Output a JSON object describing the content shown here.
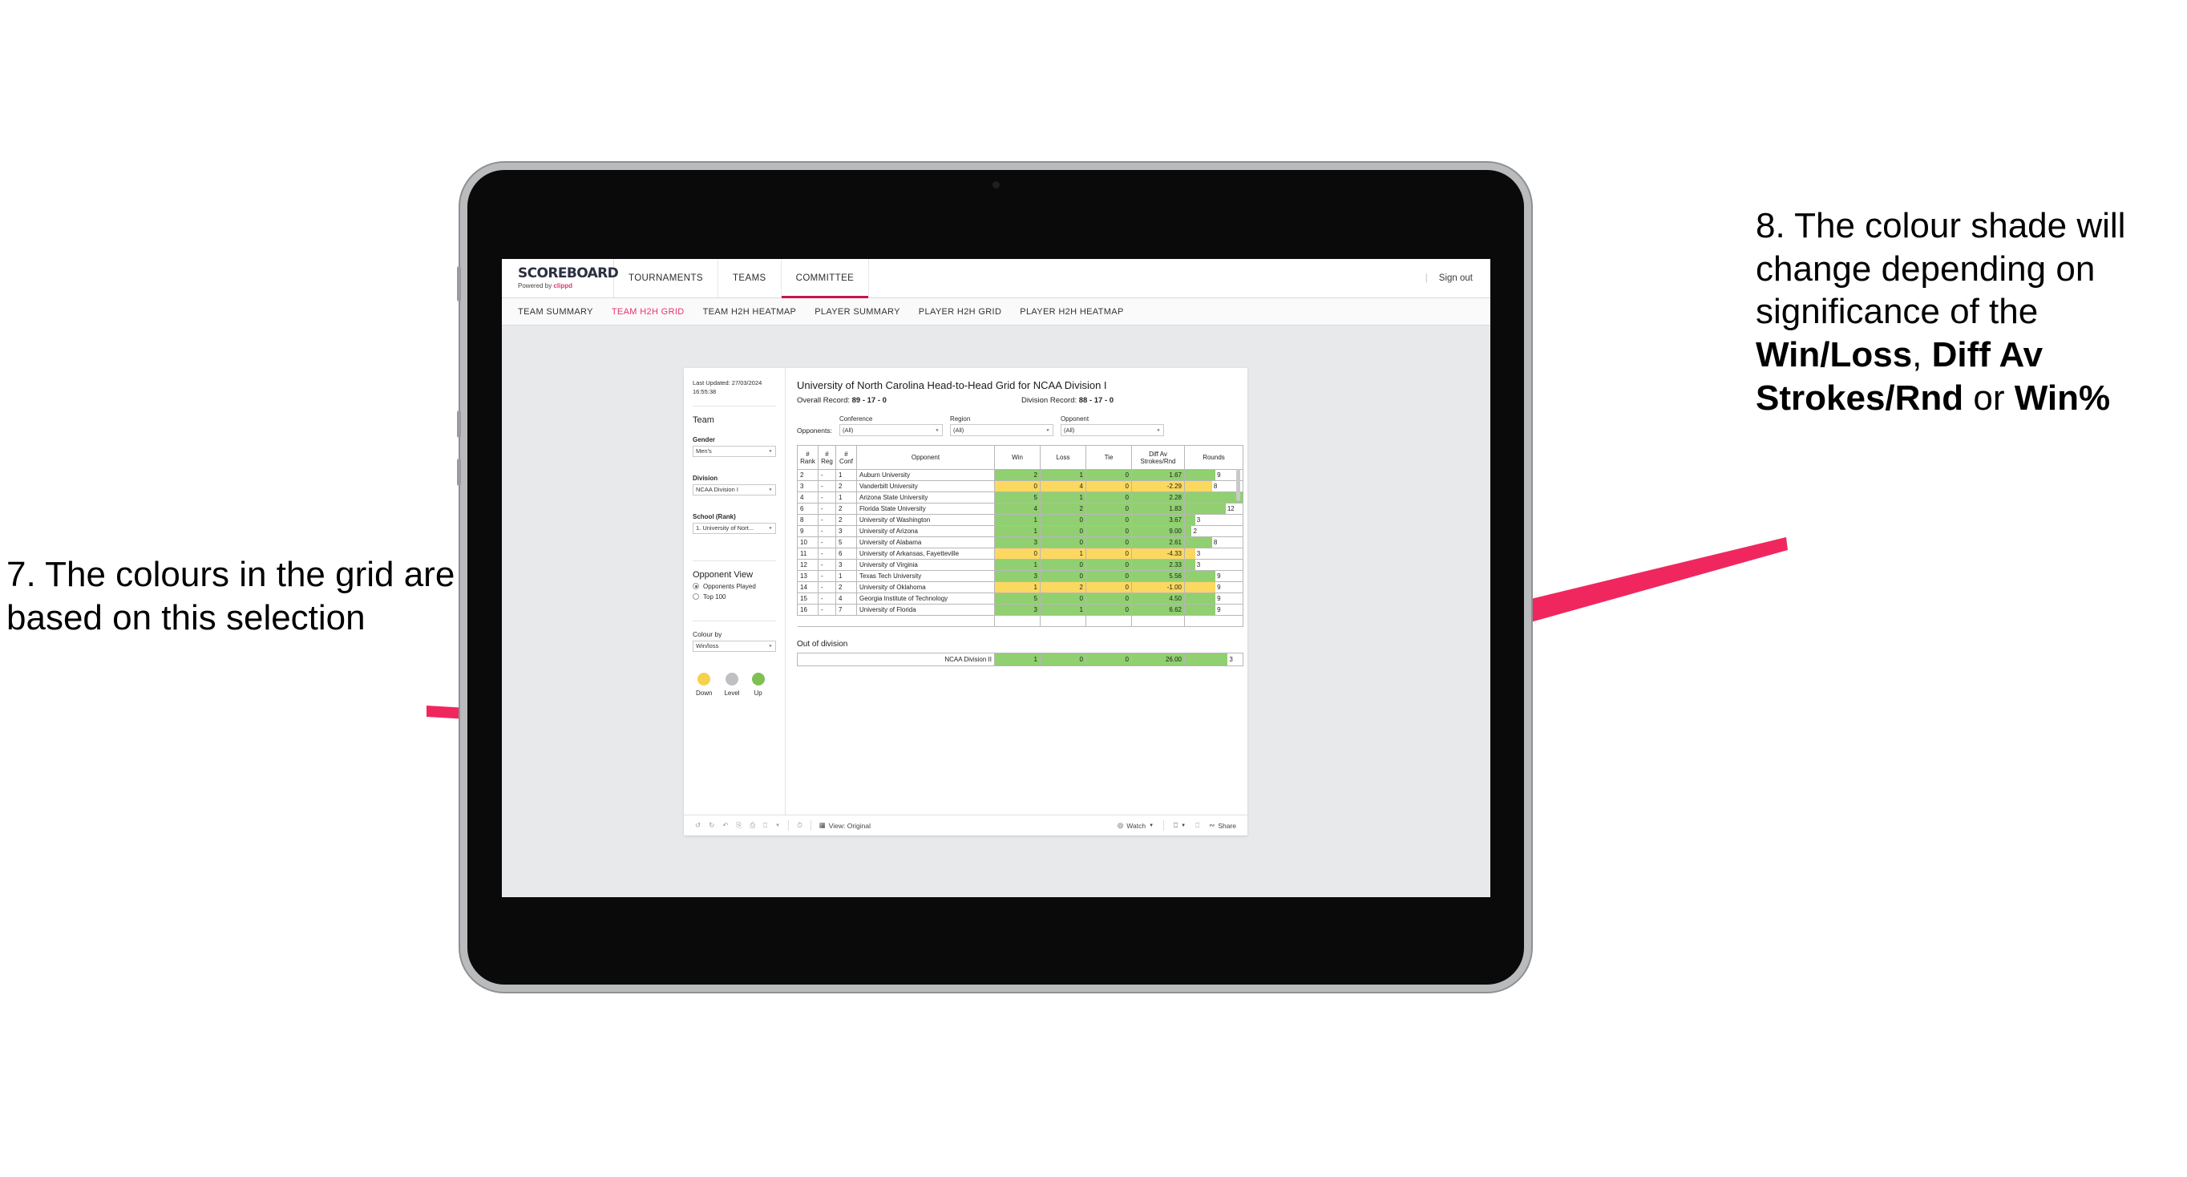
{
  "annotations": {
    "left": {
      "number": "7.",
      "text": "The colours in the grid are based on this selection"
    },
    "right": {
      "lead": "8. The colour shade will change depending on significance of the ",
      "bold1": "Win/Loss",
      "mid1": ", ",
      "bold2": "Diff Av Strokes/Rnd",
      "mid2": " or ",
      "bold3": "Win%"
    },
    "arrow_color": "#f0275f"
  },
  "topnav": {
    "brand_title": "SCOREBOARD",
    "brand_sub_prefix": "Powered by ",
    "brand_sub_accent": "clippd",
    "items": [
      {
        "label": "TOURNAMENTS",
        "active": false
      },
      {
        "label": "TEAMS",
        "active": false
      },
      {
        "label": "COMMITTEE",
        "active": true
      }
    ],
    "separator": "|",
    "sign_out": "Sign out",
    "accent_color": "#c8154b"
  },
  "subnav": {
    "items": [
      {
        "label": "TEAM SUMMARY",
        "active": false
      },
      {
        "label": "TEAM H2H GRID",
        "active": true
      },
      {
        "label": "TEAM H2H HEATMAP",
        "active": false
      },
      {
        "label": "PLAYER SUMMARY",
        "active": false
      },
      {
        "label": "PLAYER H2H GRID",
        "active": false
      },
      {
        "label": "PLAYER H2H HEATMAP",
        "active": false
      }
    ],
    "active_color": "#e8336b"
  },
  "sidebar": {
    "last_updated": "Last Updated: 27/03/2024 16:55:38",
    "team_heading": "Team",
    "gender": {
      "label": "Gender",
      "value": "Men's"
    },
    "division": {
      "label": "Division",
      "value": "NCAA Division I"
    },
    "school": {
      "label": "School (Rank)",
      "value": "1. University of Nort..."
    },
    "opponent_view": {
      "heading": "Opponent View",
      "options": [
        {
          "label": "Opponents Played",
          "selected": true
        },
        {
          "label": "Top 100",
          "selected": false
        }
      ]
    },
    "colour_by": {
      "label": "Colour by",
      "value": "Win/loss"
    },
    "legend": [
      {
        "label": "Down",
        "color": "#f5d24e"
      },
      {
        "label": "Level",
        "color": "#bfc0c2"
      },
      {
        "label": "Up",
        "color": "#7ec153"
      }
    ]
  },
  "viz": {
    "title": "University of North Carolina Head-to-Head Grid for NCAA Division I",
    "overall_record_label": "Overall Record: ",
    "overall_record_value": "89 - 17 - 0",
    "division_record_label": "Division Record: ",
    "division_record_value": "88 - 17 - 0",
    "opponents_label": "Opponents:",
    "filters": [
      {
        "label": "Conference",
        "value": "(All)"
      },
      {
        "label": "Region",
        "value": "(All)"
      },
      {
        "label": "Opponent",
        "value": "(All)"
      }
    ]
  },
  "chart_data": {
    "type": "table",
    "title": "University of North Carolina Head-to-Head Grid for NCAA Division I",
    "columns": [
      "# Rank",
      "# Reg",
      "# Conf",
      "Opponent",
      "Win",
      "Loss",
      "Tie",
      "Diff Av Strokes/Rnd",
      "Rounds"
    ],
    "column_headers_multiline": [
      [
        "#",
        "Rank"
      ],
      [
        "#",
        "Reg"
      ],
      [
        "#",
        "Conf"
      ],
      [
        "Opponent"
      ],
      [
        "Win"
      ],
      [
        "Loss"
      ],
      [
        "Tie"
      ],
      [
        "Diff Av",
        "Strokes/Rnd"
      ],
      [
        "Rounds"
      ]
    ],
    "rounds_max": 17,
    "colors": {
      "up": "#90d070",
      "down": "#fbd85f",
      "level": "#bfc0c2"
    },
    "rows": [
      {
        "rank": "2",
        "reg": "-",
        "conf": "1",
        "opponent": "Auburn University",
        "win": "2",
        "loss": "1",
        "tie": "0",
        "diff": "1.67",
        "rounds": "9",
        "state": "up"
      },
      {
        "rank": "3",
        "reg": "-",
        "conf": "2",
        "opponent": "Vanderbilt University",
        "win": "0",
        "loss": "4",
        "tie": "0",
        "diff": "-2.29",
        "rounds": "8",
        "state": "down"
      },
      {
        "rank": "4",
        "reg": "-",
        "conf": "1",
        "opponent": "Arizona State University",
        "win": "5",
        "loss": "1",
        "tie": "0",
        "diff": "2.28",
        "rounds": "17",
        "state": "up"
      },
      {
        "rank": "6",
        "reg": "-",
        "conf": "2",
        "opponent": "Florida State University",
        "win": "4",
        "loss": "2",
        "tie": "0",
        "diff": "1.83",
        "rounds": "12",
        "state": "up"
      },
      {
        "rank": "8",
        "reg": "-",
        "conf": "2",
        "opponent": "University of Washington",
        "win": "1",
        "loss": "0",
        "tie": "0",
        "diff": "3.67",
        "rounds": "3",
        "state": "up"
      },
      {
        "rank": "9",
        "reg": "-",
        "conf": "3",
        "opponent": "University of Arizona",
        "win": "1",
        "loss": "0",
        "tie": "0",
        "diff": "9.00",
        "rounds": "2",
        "state": "up"
      },
      {
        "rank": "10",
        "reg": "-",
        "conf": "5",
        "opponent": "University of Alabama",
        "win": "3",
        "loss": "0",
        "tie": "0",
        "diff": "2.61",
        "rounds": "8",
        "state": "up"
      },
      {
        "rank": "11",
        "reg": "-",
        "conf": "6",
        "opponent": "University of Arkansas, Fayetteville",
        "win": "0",
        "loss": "1",
        "tie": "0",
        "diff": "-4.33",
        "rounds": "3",
        "state": "down"
      },
      {
        "rank": "12",
        "reg": "-",
        "conf": "3",
        "opponent": "University of Virginia",
        "win": "1",
        "loss": "0",
        "tie": "0",
        "diff": "2.33",
        "rounds": "3",
        "state": "up"
      },
      {
        "rank": "13",
        "reg": "-",
        "conf": "1",
        "opponent": "Texas Tech University",
        "win": "3",
        "loss": "0",
        "tie": "0",
        "diff": "5.56",
        "rounds": "9",
        "state": "up"
      },
      {
        "rank": "14",
        "reg": "-",
        "conf": "2",
        "opponent": "University of Oklahoma",
        "win": "1",
        "loss": "2",
        "tie": "0",
        "diff": "-1.00",
        "rounds": "9",
        "state": "down"
      },
      {
        "rank": "15",
        "reg": "-",
        "conf": "4",
        "opponent": "Georgia Institute of Technology",
        "win": "5",
        "loss": "0",
        "tie": "0",
        "diff": "4.50",
        "rounds": "9",
        "state": "up"
      },
      {
        "rank": "16",
        "reg": "-",
        "conf": "7",
        "opponent": "University of Florida",
        "win": "3",
        "loss": "1",
        "tie": "0",
        "diff": "6.62",
        "rounds": "9",
        "state": "up"
      }
    ],
    "out_of_division": {
      "heading": "Out of division",
      "row": {
        "name": "NCAA Division II",
        "win": "1",
        "loss": "0",
        "tie": "0",
        "diff": "26.00",
        "rounds": "3",
        "state": "up"
      }
    }
  },
  "toolbar": {
    "view_label": "View: Original",
    "watch_label": "Watch",
    "share_label": "Share"
  }
}
